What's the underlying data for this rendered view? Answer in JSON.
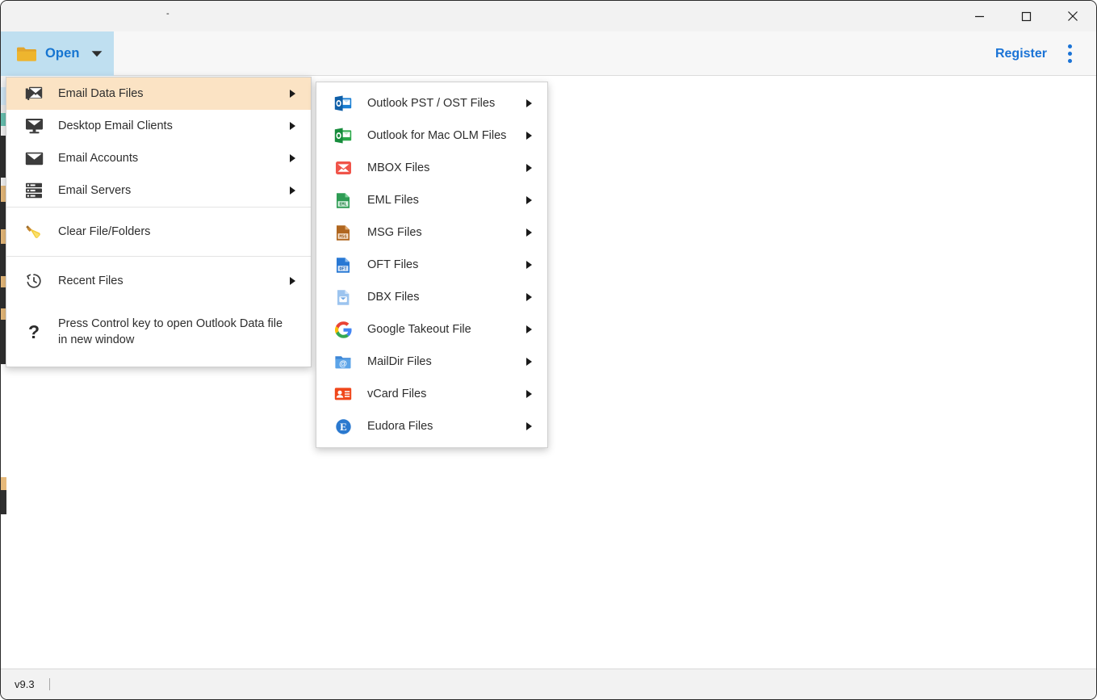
{
  "window": {
    "title": "-",
    "controls": [
      {
        "name": "minimize",
        "glyph": "—"
      },
      {
        "name": "maximize",
        "glyph": "□"
      },
      {
        "name": "close",
        "glyph": "✕"
      }
    ]
  },
  "toolbar": {
    "open_label": "Open",
    "open_icon": "folder-icon",
    "register_label": "Register",
    "more_icon": "kebab-menu-icon",
    "accent_blue": "#1a73d6",
    "open_bg": "#bfdff0",
    "folder_color": "#e0a020"
  },
  "main_menu": {
    "highlight_color": "#fbe3c4",
    "items": [
      {
        "label": "Email Data Files",
        "icon": "open-envelope-icon",
        "arrow": true,
        "active": true
      },
      {
        "label": "Desktop Email Clients",
        "icon": "monitor-mail-icon",
        "arrow": true,
        "active": false
      },
      {
        "label": "Email Accounts",
        "icon": "envelope-icon",
        "arrow": true,
        "active": false
      },
      {
        "label": "Email Servers",
        "icon": "server-icon",
        "arrow": true,
        "active": false
      }
    ],
    "clear": {
      "label": "Clear File/Folders",
      "icon": "broom-icon",
      "arrow": false
    },
    "recent": {
      "label": "Recent Files",
      "icon": "history-clock-icon",
      "arrow": true
    },
    "hint": {
      "label": "Press Control key to open Outlook Data file in new window",
      "icon": "question-mark-icon"
    }
  },
  "sub_menu": {
    "items": [
      {
        "label": "Outlook PST / OST Files",
        "icon": "outlook-pst-icon",
        "color": "#0f6cbd"
      },
      {
        "label": "Outlook for Mac OLM Files",
        "icon": "outlook-olm-icon",
        "color": "#1e9e4a"
      },
      {
        "label": "MBOX Files",
        "icon": "mbox-envelope-icon",
        "color": "#f05545"
      },
      {
        "label": "EML Files",
        "icon": "eml-file-icon",
        "color": "#1e9e4a"
      },
      {
        "label": "MSG Files",
        "icon": "msg-file-icon",
        "color": "#b5651d"
      },
      {
        "label": "OFT Files",
        "icon": "oft-file-icon",
        "color": "#1d6fd0"
      },
      {
        "label": "DBX Files",
        "icon": "dbx-file-icon",
        "color": "#7aa9e8"
      },
      {
        "label": "Google Takeout File",
        "icon": "google-logo-icon",
        "color": "#4285f4"
      },
      {
        "label": "MailDir Files",
        "icon": "maildir-folder-icon",
        "color": "#4a90e2"
      },
      {
        "label": "vCard Files",
        "icon": "vcard-contact-icon",
        "color": "#f0471b"
      },
      {
        "label": "Eudora Files",
        "icon": "eudora-e-icon",
        "color": "#1d6fd0"
      }
    ]
  },
  "statusbar": {
    "version": "v9.3"
  }
}
